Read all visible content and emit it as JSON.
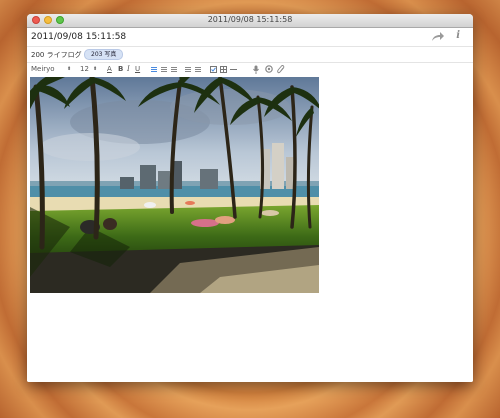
{
  "window": {
    "title": "2011/09/08 15:11:58"
  },
  "note": {
    "title": "2011/09/08 15:11:58",
    "notebook": "200 ライフログ",
    "tag": "203 写真"
  },
  "toolbar": {
    "font_name": "Meiryo",
    "font_size": "12",
    "bold": "B",
    "italic": "I",
    "underline": "U",
    "text_color": "A"
  },
  "icons": {
    "share": "share-arrow-icon",
    "info": "info-icon",
    "mic": "microphone-icon",
    "camera": "camera-icon",
    "attach": "paperclip-icon"
  },
  "colors": {
    "accent": "#4a8be0",
    "tag_bg": "#d6e2f5"
  }
}
